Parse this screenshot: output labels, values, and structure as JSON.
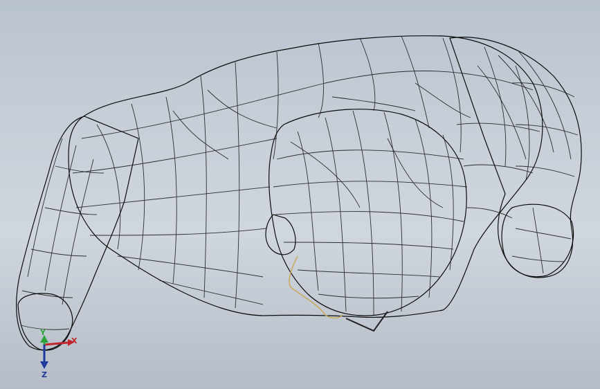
{
  "viewport": {
    "background_top": "#b9c3cf",
    "background_bottom": "#b4bcc7",
    "model_color": "#5a5a5a",
    "mesh_line_color": "#111111",
    "sketch_color": "#c9a85a"
  },
  "triad": {
    "x_label": "X",
    "y_label": "Y",
    "z_label": "Z",
    "x_color": "#c0262b",
    "y_color": "#2fa33a",
    "z_color": "#1d3a9b"
  }
}
